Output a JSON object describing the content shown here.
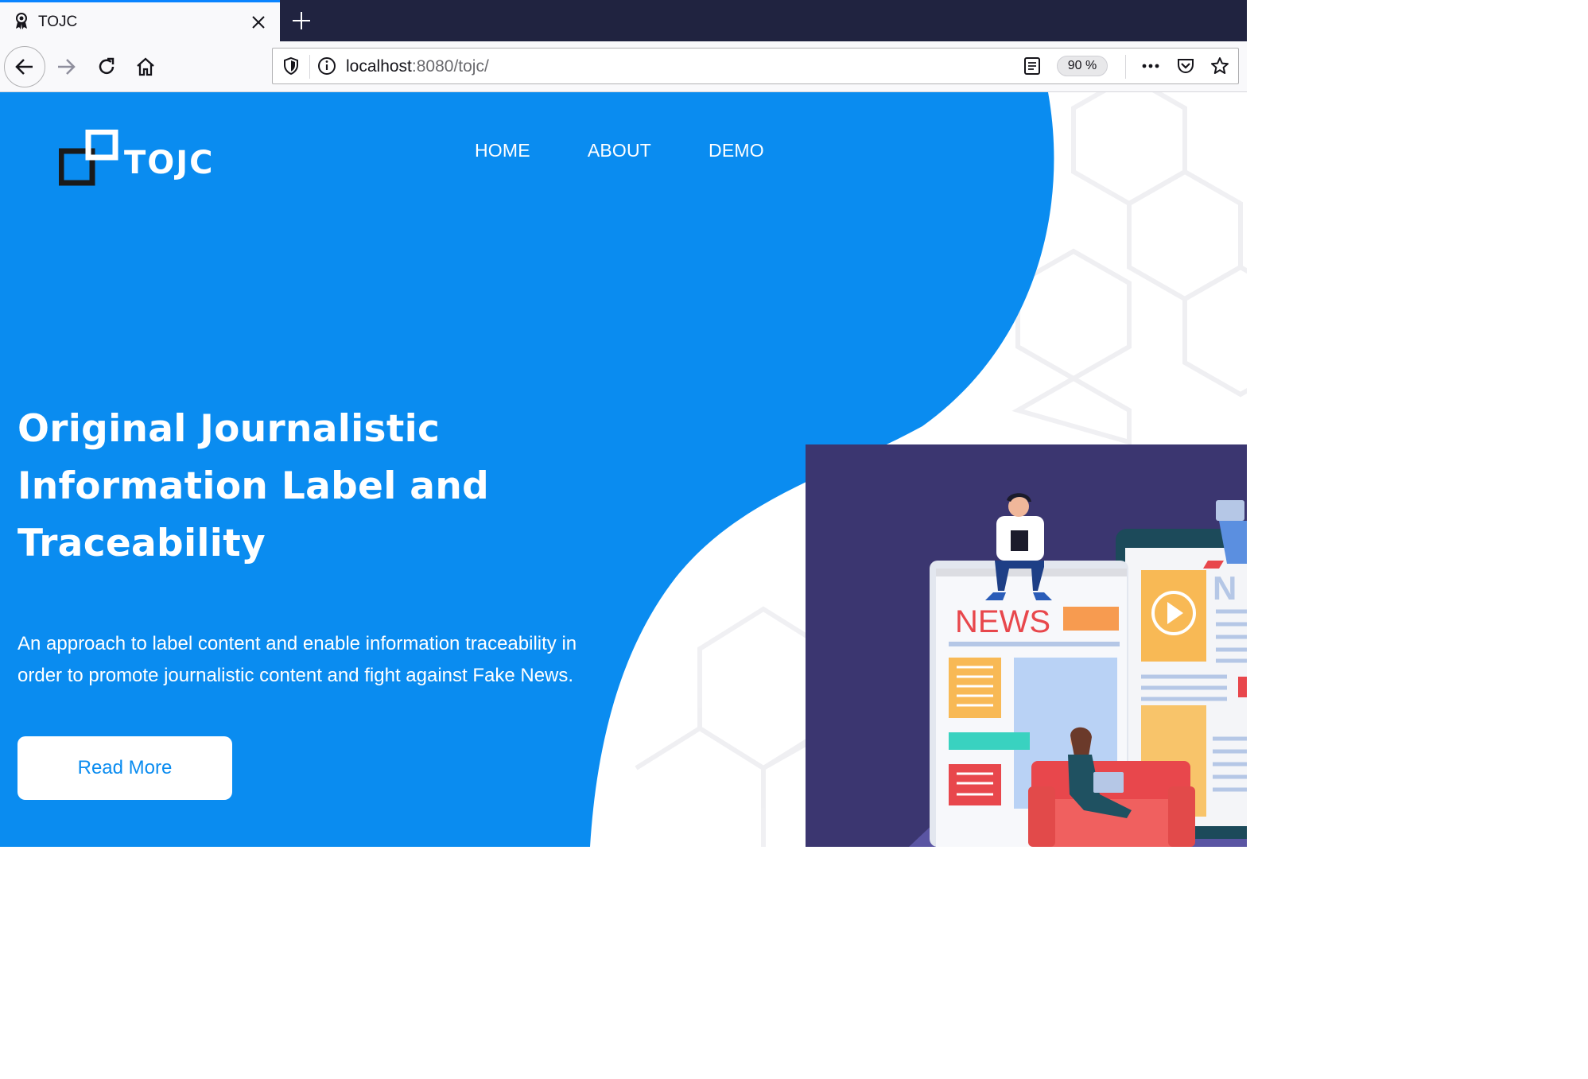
{
  "browser": {
    "tab_title": "TOJC",
    "url_host": "localhost",
    "url_path": ":8080/tojc/",
    "zoom": "90 %"
  },
  "site": {
    "logo_text": "TOJC",
    "nav": [
      "HOME",
      "ABOUT",
      "DEMO"
    ]
  },
  "hero": {
    "title": "Original Journalistic Information Label and Traceability",
    "description": "An approach to label content and enable information traceability in order to promote journalistic content and fight against Fake News.",
    "cta_label": "Read More"
  },
  "illustration": {
    "sign_text": "NEWS",
    "sign_text_partial": "N"
  },
  "colors": {
    "hero_blue": "#0a8cf0",
    "illustration_bg": "#3b3670",
    "tab_bar": "#202340",
    "news_red": "#e8474c"
  }
}
